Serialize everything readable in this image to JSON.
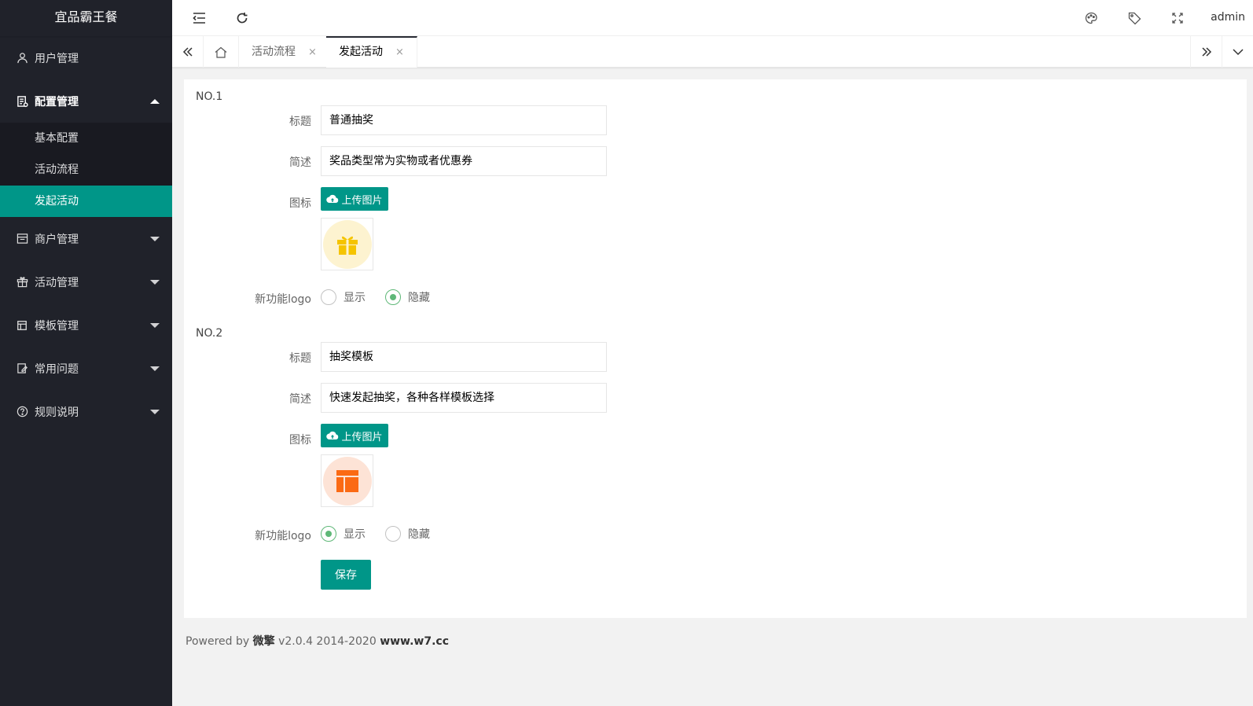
{
  "app": {
    "title": "宜品霸王餐"
  },
  "sidebar": {
    "items": [
      {
        "label": "用户管理",
        "icon": "user-icon"
      },
      {
        "label": "配置管理",
        "icon": "config-icon",
        "open": true,
        "children": [
          {
            "label": "基本配置"
          },
          {
            "label": "活动流程"
          },
          {
            "label": "发起活动",
            "active": true
          }
        ]
      },
      {
        "label": "商户管理",
        "icon": "shop-icon"
      },
      {
        "label": "活动管理",
        "icon": "gift-icon"
      },
      {
        "label": "模板管理",
        "icon": "template-icon"
      },
      {
        "label": "常用问题",
        "icon": "question-edit-icon"
      },
      {
        "label": "规则说明",
        "icon": "help-circle-icon"
      }
    ]
  },
  "header": {
    "user": "admin"
  },
  "tabs": [
    {
      "label": "活动流程",
      "close": "×"
    },
    {
      "label": "发起活动",
      "close": "×",
      "active": true
    }
  ],
  "form": {
    "sections": [
      {
        "number": "NO.1",
        "title_label": "标题",
        "title_value": "普通抽奖",
        "desc_label": "简述",
        "desc_value": "奖品类型常为实物或者优惠券",
        "icon_label": "图标",
        "upload_label": "上传图片",
        "logo_label": "新功能logo",
        "radio_show": "显示",
        "radio_hide": "隐藏",
        "selected": "hide",
        "image_icon": "gift-icon",
        "image_color": "#f5c400",
        "image_bg": "#fdf3d0"
      },
      {
        "number": "NO.2",
        "title_label": "标题",
        "title_value": "抽奖模板",
        "desc_label": "简述",
        "desc_value": "快速发起抽奖，各种各样模板选择",
        "icon_label": "图标",
        "upload_label": "上传图片",
        "logo_label": "新功能logo",
        "radio_show": "显示",
        "radio_hide": "隐藏",
        "selected": "show",
        "image_icon": "layout-icon",
        "image_color": "#fb6a14",
        "image_bg": "#fde3d6"
      }
    ],
    "save_label": "保存"
  },
  "footer": {
    "prefix": "Powered by",
    "brand": "微擎",
    "version": "v2.0.4 2014-2020",
    "site": "www.w7.cc"
  },
  "colors": {
    "accent": "#009688",
    "sidebar_bg": "#20222a",
    "radio_on": "#5fb878"
  }
}
